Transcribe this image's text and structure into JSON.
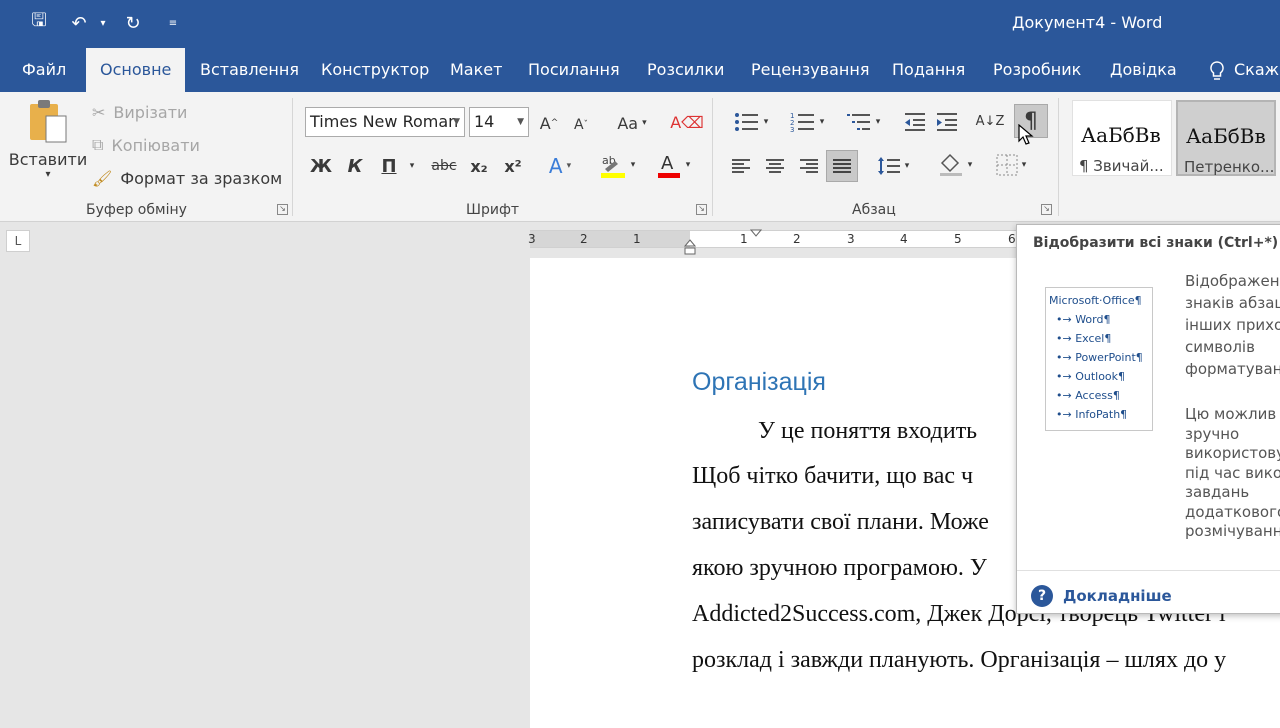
{
  "titlebar": {
    "title": "Документ4  -  Word",
    "qat": {
      "save": "🖫",
      "undo": "↶",
      "undo_drop": "▾",
      "redo": "↻",
      "customize": "≡"
    }
  },
  "tabs": [
    "Файл",
    "Основне",
    "Вставлення",
    "Конструктор",
    "Макет",
    "Посилання",
    "Розсилки",
    "Рецензування",
    "Подання",
    "Розробник",
    "Довідка"
  ],
  "search": {
    "icon": "lightbulb-icon",
    "label": "Скаж"
  },
  "clipboard": {
    "paste": "Вставити",
    "cut": "Вирізати",
    "copy": "Копіювати",
    "format_painter": "Формат за зразком",
    "group": "Буфер обміну"
  },
  "font": {
    "name": "Times New Roman",
    "size": "14",
    "bold": "Ж",
    "italic": "К",
    "underline": "П",
    "strike": "abc",
    "subscript": "x₂",
    "superscript": "x²",
    "grow": "A",
    "shrink": "A",
    "change_case": "Aa",
    "group": "Шрифт"
  },
  "paragraph": {
    "group": "Абзац",
    "pilcrow": "¶",
    "sort": "A↓Z"
  },
  "styles": [
    {
      "sample": "АаБбВв",
      "name": "¶ Звичай..."
    },
    {
      "sample": "АаБбВв",
      "name": "Петренко..."
    }
  ],
  "ruler": {
    "corner": "L",
    "ticks": [
      "3",
      "2",
      "1",
      "1",
      "2",
      "3",
      "4",
      "5",
      "6"
    ]
  },
  "document": {
    "heading": "Організація",
    "lines": [
      "У  це  поняття  входить",
      "Щоб  чітко  бачити,  що  вас  ч",
      "записувати свої плани. Може",
      "якою  зручною  програмою.  У",
      "Addicted2Success.com, Джек Дорсі, творець Twitter і",
      "розклад і завжди планують. Організація – шлях до у"
    ]
  },
  "tooltip": {
    "title": "Відобразити всі знаки (Ctrl+*)",
    "illustration": [
      "Microsoft·Office¶",
      "•→ Word¶",
      "•→ Excel¶",
      "•→ PowerPoint¶",
      "•→ Outlook¶",
      "•→ Access¶",
      "•→ InfoPath¶"
    ],
    "text1": [
      "Відображен",
      "знаків абзац",
      "інших прихо",
      "символів",
      "форматуван"
    ],
    "text2": [
      "Цю можлив",
      "зручно",
      "використову",
      "під час вико",
      "завдань",
      "додаткового",
      "розмічуванн"
    ],
    "help_icon": "?",
    "more": "Докладніше"
  },
  "colors": {
    "accent": "#2b579a",
    "heading": "#2e74b5",
    "ribbon": "#f3f3f3",
    "workspace": "#e6e6e6"
  }
}
